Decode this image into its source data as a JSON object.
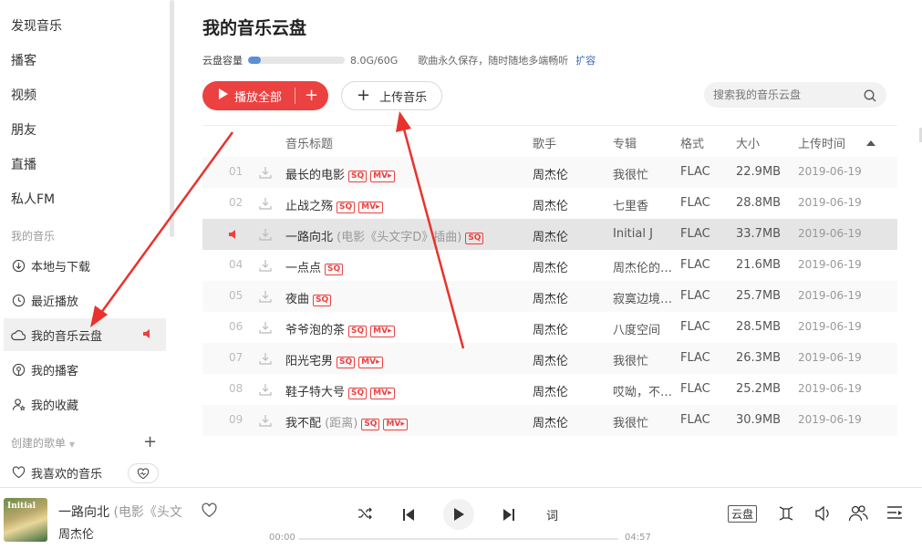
{
  "sidebar": {
    "nav": [
      "发现音乐",
      "播客",
      "视频",
      "朋友",
      "直播",
      "私人FM"
    ],
    "my_music_label": "我的音乐",
    "my_items": [
      {
        "label": "本地与下载",
        "icon": "download-cloud-icon"
      },
      {
        "label": "最近播放",
        "icon": "clock-icon"
      },
      {
        "label": "我的音乐云盘",
        "icon": "cloud-icon"
      },
      {
        "label": "我的播客",
        "icon": "podcast-icon"
      },
      {
        "label": "我的收藏",
        "icon": "user-star-icon"
      }
    ],
    "created_playlists_label": "创建的歌单",
    "favorite_label": "我喜欢的音乐"
  },
  "main": {
    "title": "我的音乐云盘",
    "capacity_label": "云盘容量",
    "capacity_text": "8.0G/60G",
    "capacity_fraction": 0.133,
    "capacity_note": "歌曲永久保存，随时随地多端畅听",
    "expand_label": "扩容",
    "play_all_label": "播放全部",
    "upload_label": "上传音乐",
    "search_placeholder": "搜索我的音乐云盘",
    "columns": [
      "音乐标题",
      "歌手",
      "专辑",
      "格式",
      "大小",
      "上传时间"
    ],
    "rows": [
      {
        "num": "01",
        "title": "最长的电影",
        "extra": "",
        "sq": true,
        "mv": true,
        "artist": "周杰伦",
        "album": "我很忙",
        "format": "FLAC",
        "size": "22.9MB",
        "date": "2019-06-19"
      },
      {
        "num": "02",
        "title": "止战之殇",
        "extra": "",
        "sq": true,
        "mv": true,
        "artist": "周杰伦",
        "album": "七里香",
        "format": "FLAC",
        "size": "28.8MB",
        "date": "2019-06-19"
      },
      {
        "num": "",
        "title": "一路向北",
        "extra": "(电影《头文字D》插曲)",
        "sq": true,
        "mv": false,
        "artist": "周杰伦",
        "album": "Initial J",
        "format": "FLAC",
        "size": "33.7MB",
        "date": "2019-06-19",
        "playing": true
      },
      {
        "num": "04",
        "title": "一点点",
        "extra": "",
        "sq": true,
        "mv": false,
        "artist": "周杰伦",
        "album": "周杰伦的…",
        "format": "FLAC",
        "size": "21.6MB",
        "date": "2019-06-19"
      },
      {
        "num": "05",
        "title": "夜曲",
        "extra": "",
        "sq": true,
        "mv": false,
        "artist": "周杰伦",
        "album": "寂寞边境…",
        "format": "FLAC",
        "size": "25.7MB",
        "date": "2019-06-19"
      },
      {
        "num": "06",
        "title": "爷爷泡的茶",
        "extra": "",
        "sq": true,
        "mv": true,
        "artist": "周杰伦",
        "album": "八度空间",
        "format": "FLAC",
        "size": "28.5MB",
        "date": "2019-06-19"
      },
      {
        "num": "07",
        "title": "阳光宅男",
        "extra": "",
        "sq": true,
        "mv": true,
        "artist": "周杰伦",
        "album": "我很忙",
        "format": "FLAC",
        "size": "26.3MB",
        "date": "2019-06-19"
      },
      {
        "num": "08",
        "title": "鞋子特大号",
        "extra": "",
        "sq": true,
        "mv": true,
        "artist": "周杰伦",
        "album": "哎呦，不…",
        "format": "FLAC",
        "size": "25.2MB",
        "date": "2019-06-19"
      },
      {
        "num": "09",
        "title": "我不配",
        "extra": "(距离)",
        "sq": true,
        "mv": true,
        "artist": "周杰伦",
        "album": "我很忙",
        "format": "FLAC",
        "size": "30.9MB",
        "date": "2019-06-19"
      }
    ],
    "tag_sq": "SQ",
    "tag_mv": "MV▸"
  },
  "player": {
    "cover_text": "Initial",
    "song_title": "一路向北",
    "song_extra": "(电影《头文",
    "artist": "周杰伦",
    "time_current": "00:00",
    "time_total": "04:57",
    "lyric_label": "词",
    "cloud_label": "云盘"
  },
  "colors": {
    "accent": "#ec4141",
    "annotation_arrow": "#e8332d"
  }
}
